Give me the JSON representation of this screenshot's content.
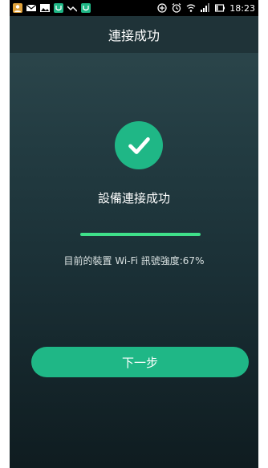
{
  "status_bar": {
    "time": "18:23",
    "left_icons": [
      "contact-icon",
      "gmail-icon",
      "gallery-icon",
      "app-icon",
      "trend-icon",
      "app-icon"
    ],
    "right_icons": [
      "data-saver-icon",
      "alarm-icon",
      "wifi-icon",
      "signal-icon",
      "battery-icon"
    ]
  },
  "header": {
    "title": "連接成功"
  },
  "main": {
    "status_text": "設備連接成功",
    "signal_text": "目前的裝置 Wi-Fi 訊號強度:67%",
    "progress_percent": 100,
    "next_button_label": "下一步"
  },
  "colors": {
    "accent": "#1fb786",
    "progress": "#3fe08a",
    "background_top": "#2f4a4f",
    "background_bottom": "#0f1c20"
  }
}
